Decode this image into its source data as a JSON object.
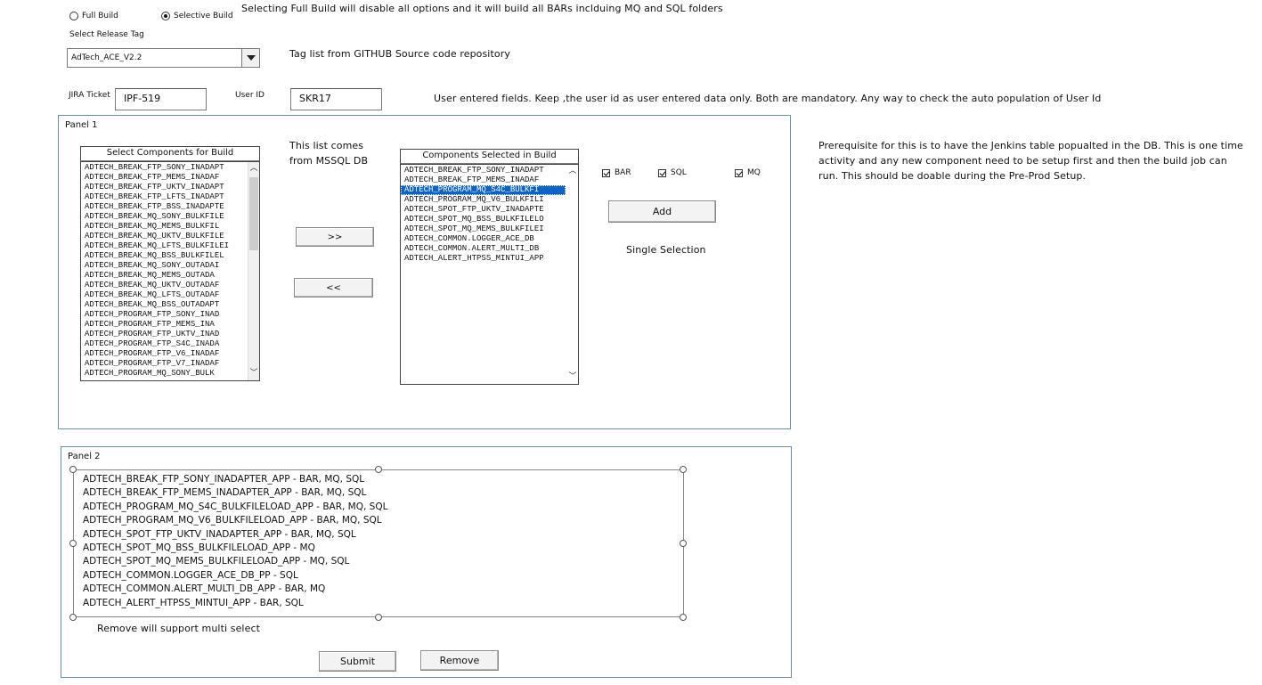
{
  "build_mode": {
    "options": [
      {
        "label": "Full Build",
        "selected": false
      },
      {
        "label": "Selective Build",
        "selected": true
      }
    ],
    "note": "Selecting Full Build will disable all options and it will build all BARs inclduing MQ and SQL folders"
  },
  "release_tag": {
    "label": "Select Release Tag",
    "value": "AdTech_ACE_V2.2",
    "note": "Tag list from GITHUB Source code repository"
  },
  "jira": {
    "label": "JIRA Ticket",
    "value": "IPF-519"
  },
  "user": {
    "label": "User ID",
    "value": "SKR17"
  },
  "fields_note": "User entered fields. Keep ,the user id as user entered data only. Both are mandatory. Any way to check the auto population of User Id",
  "panel1": {
    "title": "Panel 1",
    "available_header": "Select Components for Build",
    "available_note_line1": "This list comes",
    "available_note_line2": "from MSSQL DB",
    "available_items": [
      "ADTECH_BREAK_FTP_SONY_INADAPT",
      "ADTECH_BREAK_FTP_MEMS_INADAF",
      "ADTECH_BREAK_FTP_UKTV_INADAPT",
      "ADTECH_BREAK_FTP_LFTS_INADAPT",
      "ADTECH_BREAK_FTP_BSS_INADAPTE",
      "ADTECH_BREAK_MQ_SONY_BULKFILE",
      "ADTECH_BREAK_MQ_MEMS_BULKFIL",
      "ADTECH_BREAK_MQ_UKTV_BULKFILE",
      "ADTECH_BREAK_MQ_LFTS_BULKFILEI",
      "ADTECH_BREAK_MQ_BSS_BULKFILEL",
      "ADTECH_BREAK_MQ_SONY_OUTADAI",
      "ADTECH_BREAK_MQ_MEMS_OUTADA",
      "ADTECH_BREAK_MQ_UKTV_OUTADAF",
      "ADTECH_BREAK_MQ_LFTS_OUTADAF",
      "ADTECH_BREAK_MQ_BSS_OUTADAPT",
      "ADTECH_PROGRAM_FTP_SONY_INAD",
      "ADTECH_PROGRAM_FTP_MEMS_INA",
      "ADTECH_PROGRAM_FTP_UKTV_INAD",
      "ADTECH_PROGRAM_FTP_S4C_INADA",
      "ADTECH_PROGRAM_FTP_V6_INADAF",
      "ADTECH_PROGRAM_FTP_V7_INADAF",
      "ADTECH_PROGRAM_MQ_SONY_BULK"
    ],
    "move_right_label": ">>",
    "move_left_label": "<<",
    "selected_header": "Components Selected in Build",
    "selected_items": [
      "ADTECH_BREAK_FTP_SONY_INADAPT",
      "ADTECH_BREAK_FTP_MEMS_INADAF",
      "ADTECH_PROGRAM_MQ_S4C_BULKFI",
      "ADTECH_PROGRAM_MQ_V6_BULKFILI",
      "ADTECH_SPOT_FTP_UKTV_INADAPTE",
      "ADTECH_SPOT_MQ_BSS_BULKFILELO",
      "ADTECH_SPOT_MQ_MEMS_BULKFILEI",
      "ADTECH_COMMON.LOGGER_ACE_DB",
      "ADTECH_COMMON.ALERT_MULTI_DB",
      "ADTECH_ALERT_HTPSS_MINTUI_APP"
    ],
    "checkboxes": [
      {
        "label": "BAR",
        "checked": true
      },
      {
        "label": "SQL",
        "checked": true
      },
      {
        "label": "MQ",
        "checked": true
      }
    ],
    "add_label": "Add",
    "single_selection_note": "Single Selection"
  },
  "prereq_note": "Prerequisite for this is to have the Jenkins table popualted in the DB. This is one time activity and any new component need to be setup first and then the build job can run. This should be doable during the Pre-Prod Setup.",
  "panel2": {
    "title": "Panel 2",
    "lines": [
      "ADTECH_BREAK_FTP_SONY_INADAPTER_APP - BAR, MQ, SQL",
      "ADTECH_BREAK_FTP_MEMS_INADAPTER_APP - BAR, MQ, SQL",
      "ADTECH_PROGRAM_MQ_S4C_BULKFILELOAD_APP - BAR, MQ, SQL",
      "ADTECH_PROGRAM_MQ_V6_BULKFILELOAD_APP - BAR, MQ, SQL",
      "ADTECH_SPOT_FTP_UKTV_INADAPTER_APP - BAR, MQ, SQL",
      "ADTECH_SPOT_MQ_BSS_BULKFILELOAD_APP - MQ",
      "ADTECH_SPOT_MQ_MEMS_BULKFILELOAD_APP - MQ, SQL",
      "ADTECH_COMMON.LOGGER_ACE_DB_PP - SQL",
      "ADTECH_COMMON.ALERT_MULTI_DB_APP - BAR, MQ",
      "ADTECH_ALERT_HTPSS_MINTUI_APP - BAR, SQL"
    ],
    "remove_note": "Remove will support multi select",
    "submit_label": "Submit",
    "remove_label": "Remove"
  }
}
